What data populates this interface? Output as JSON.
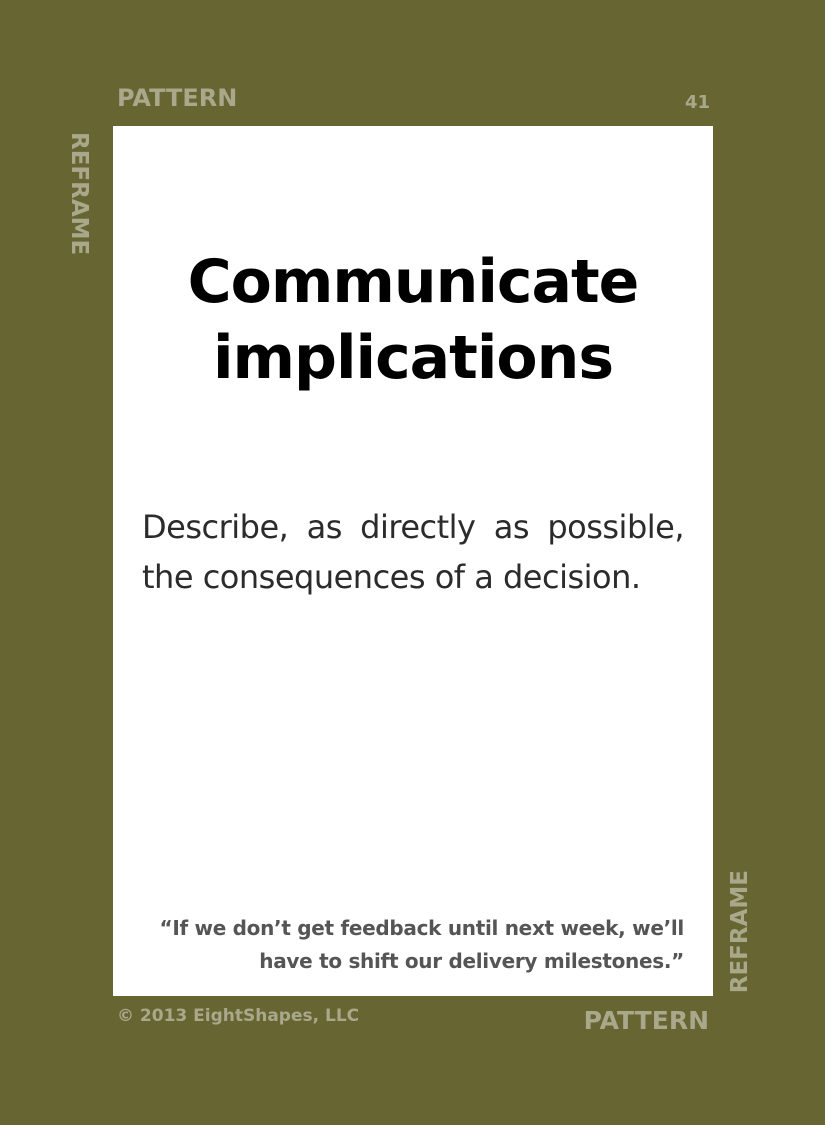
{
  "card": {
    "category": "PATTERN",
    "number": "41",
    "group": "REFRAME",
    "title": "Communicate implications",
    "description": "Describe, as directly as possible, the consequences of a decision.",
    "quote": "“If we don’t get feedback until next week, we’ll have to shift our delivery milestones.”",
    "copyright": "© 2013 EightShapes, LLC"
  },
  "colors": {
    "background": "#676532",
    "label": "#a9a88b",
    "card": "#ffffff"
  }
}
